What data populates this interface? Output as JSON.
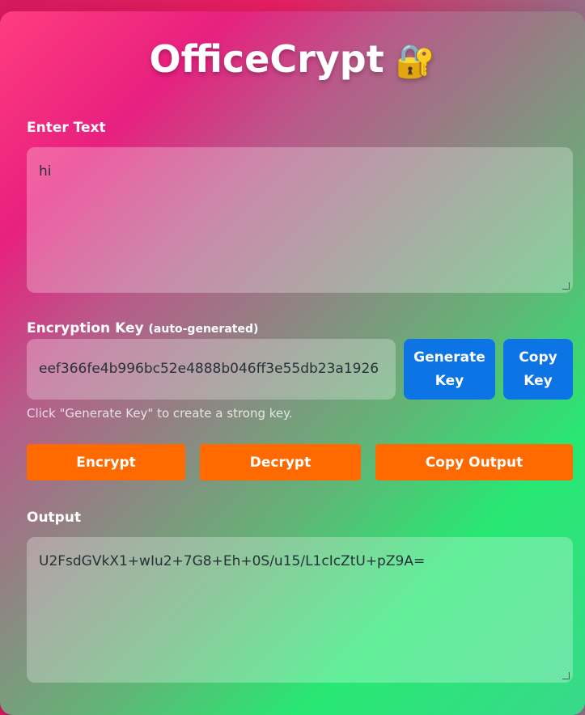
{
  "app": {
    "title": "OfficeCrypt",
    "title_icon": "🔐"
  },
  "input": {
    "label": "Enter Text",
    "value": "hi"
  },
  "key": {
    "label": "Encryption Key",
    "label_suffix": "(auto-generated)",
    "value": "eef366fe4b996bc52e4888b046ff3e55db23a1926",
    "generate_button": "Generate Key",
    "copy_button": "Copy Key",
    "hint": "Click \"Generate Key\" to create a strong key."
  },
  "actions": {
    "encrypt": "Encrypt",
    "decrypt": "Decrypt",
    "copy_output": "Copy Output"
  },
  "output": {
    "label": "Output",
    "value": "U2FsdGVkX1+wIu2+7G8+Eh+0S/u15/L1cIcZtU+pZ9A="
  },
  "colors": {
    "primary_blue": "#0c74e4",
    "action_orange": "#ff6a00",
    "gradient_pink": "#e91e63",
    "gradient_green": "#1de9b6"
  }
}
